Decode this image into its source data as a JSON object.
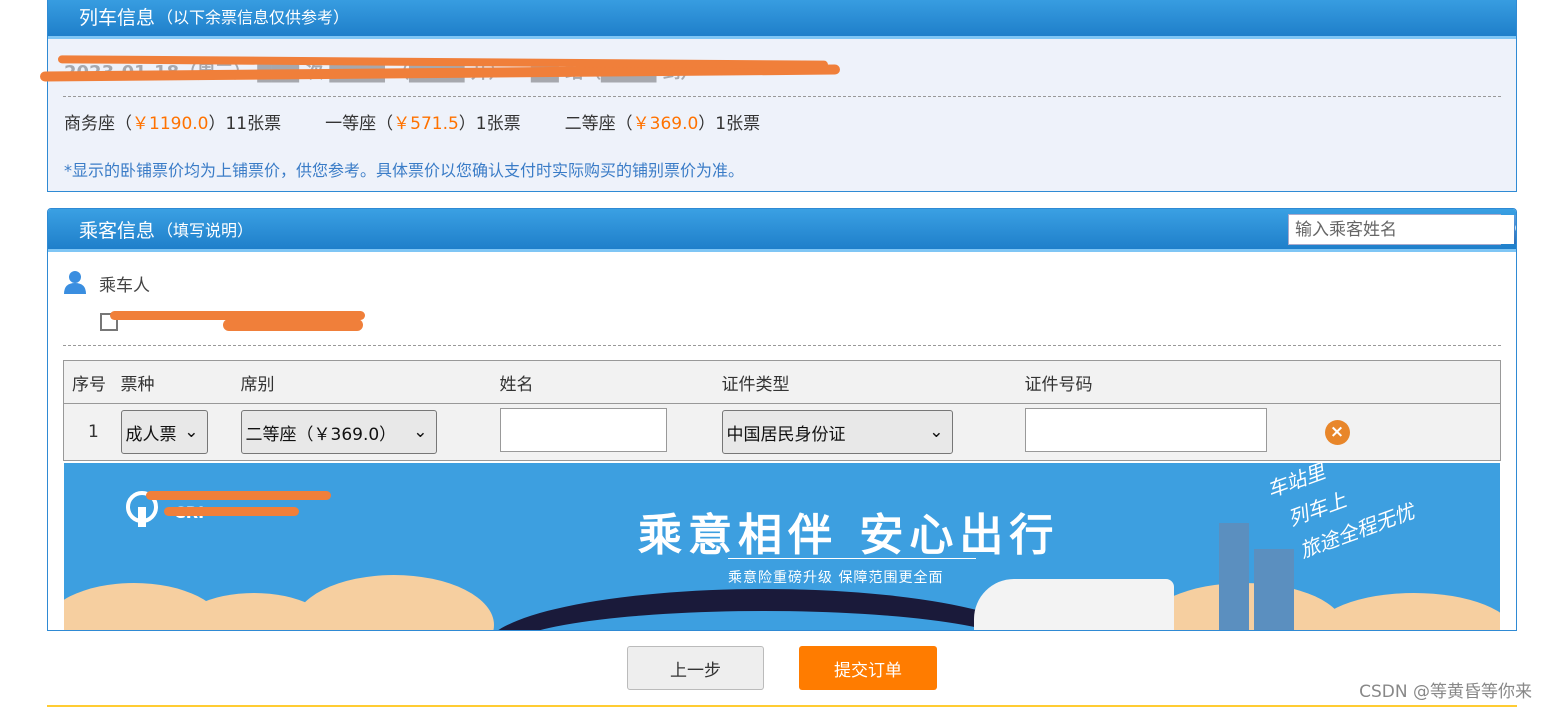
{
  "train_panel": {
    "title": "列车信息",
    "subtitle": "（以下余票信息仅供参考）",
    "seats": [
      {
        "name": "商务座（",
        "price": "￥1190.0",
        "count": "）11张票"
      },
      {
        "name": "一等座（",
        "price": "￥571.5",
        "count": "）1张票"
      },
      {
        "name": "二等座（",
        "price": "￥369.0",
        "count": "）1张票"
      }
    ],
    "note": "*显示的卧铺票价均为上铺票价，供您参考。具体票价以您确认支付时实际购买的铺别票价为准。",
    "train_line": "2023-01-18（周三） ███ 次 ████ （████ 开）— ██ 站（████ 到）"
  },
  "passenger_panel": {
    "title": "乘客信息",
    "subtitle": "（填写说明）",
    "search_placeholder": "输入乘客姓名",
    "passenger_label": "乘车人",
    "table": {
      "headers": [
        "序号",
        "票种",
        "席别",
        "姓名",
        "证件类型",
        "证件号码"
      ],
      "row": {
        "index": "1",
        "ticket_type": "成人票",
        "seat_class": "二等座（￥369.0）",
        "name": "",
        "id_type": "中国居民身份证",
        "id_number": ""
      }
    },
    "banner": {
      "title": "乘意相伴  安心出行",
      "subtitle": "乘意险重磅升级  保障范围更全面",
      "right_text": [
        "车站里",
        "列车上",
        "旅途全程无忧"
      ],
      "logo": "CRI"
    }
  },
  "actions": {
    "prev": "上一步",
    "submit": "提交订单"
  },
  "watermark": "CSDN @等黄昏等你来",
  "colors": {
    "header_blue": "#1f7fca",
    "price_orange": "#ff7200",
    "submit_orange": "#ff7c00"
  }
}
